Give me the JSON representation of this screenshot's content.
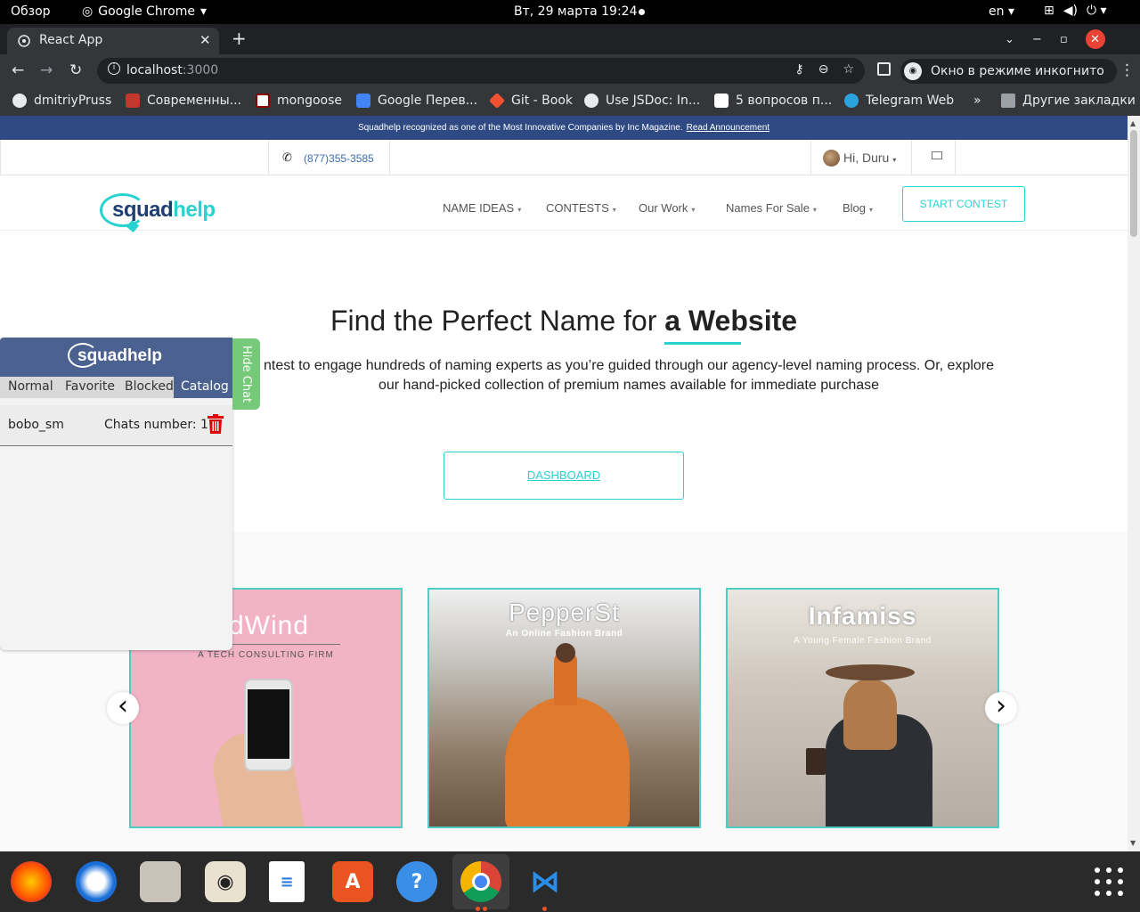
{
  "topbar": {
    "overview": "Обзор",
    "app_name": "Google Chrome",
    "datetime": "Вт, 29 марта  19:24",
    "lang": "en"
  },
  "browser": {
    "tab_title": "React App",
    "url_host": "localhost",
    "url_port": ":3000",
    "incognito_label": "Окно в режиме инкогнито",
    "bookmarks": [
      {
        "label": "dmitriyPruss",
        "icon": "github-icon"
      },
      {
        "label": "Современны...",
        "icon": "bookmark-icon"
      },
      {
        "label": "mongoose",
        "icon": "mongoose-icon"
      },
      {
        "label": "Google Перев...",
        "icon": "translate-icon"
      },
      {
        "label": "Git - Book",
        "icon": "git-icon"
      },
      {
        "label": "Use JSDoc: In...",
        "icon": "globe-icon"
      },
      {
        "label": "5 вопросов п...",
        "icon": "medium-icon"
      },
      {
        "label": "Telegram Web",
        "icon": "telegram-icon"
      },
      {
        "label": "»",
        "icon": ""
      },
      {
        "label": "Другие закладки",
        "icon": "folder-icon"
      }
    ]
  },
  "page": {
    "banner_text": "Squadhelp recognized as one of the Most Innovative Companies by Inc Magazine.",
    "banner_link": "Read Announcement",
    "phone": "(877)355-3585",
    "greeting": "Hi, Duru",
    "logo_part1": "squad",
    "logo_part2": "help",
    "nav": [
      "NAME IDEAS",
      "CONTESTS",
      "Our Work",
      "Names For Sale",
      "Blog"
    ],
    "start_contest": "START CONTEST",
    "hero_title_start": "Find the Perfect Name for",
    "hero_title_bold": "a Website",
    "hero_desc_line1": "ntest to engage hundreds of naming experts as you’re guided through our agency-level naming process. Or, explore",
    "hero_desc_line2": "our hand-picked collection of premium names available for immediate purchase",
    "dashboard": "DASHBOARD",
    "cards": [
      {
        "title": "dWind",
        "subtitle": "A TECH CONSULTING FIRM"
      },
      {
        "title": "PepperSt",
        "subtitle": "An Online Fashion Brand"
      },
      {
        "title": "Infamiss",
        "subtitle": "A Young Female Fashion Brand"
      }
    ]
  },
  "chat": {
    "logo": "squadhelp",
    "tabs": [
      "Normal",
      "Favorite",
      "Blocked",
      "Catalog"
    ],
    "active_tab": "Catalog",
    "catalog": {
      "name": "bobo_sm",
      "chats_label": "Chats number: 1"
    },
    "hide_label": "Hide Chat"
  },
  "colors": {
    "accent": "#28d2d0",
    "banner": "#2f4a82",
    "chat_header": "#4b6290",
    "hide_chat": "#77c97a"
  }
}
